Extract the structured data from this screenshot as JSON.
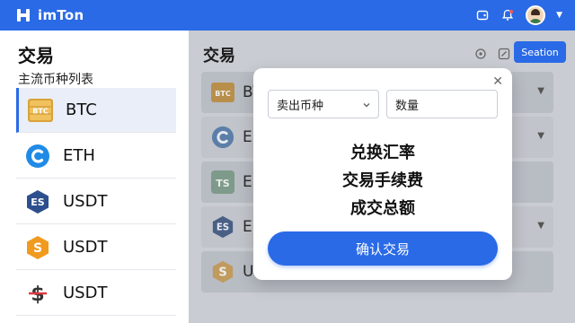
{
  "app": {
    "name": "imTon",
    "brand_color": "#2a6ae6",
    "top_icons": [
      "wallet-icon",
      "bell-icon",
      "avatar",
      "chevron-down-icon"
    ]
  },
  "sidebar": {
    "title": "交易",
    "subtitle": "主流币种列表",
    "items": [
      {
        "label": "BTC",
        "icon": "btc-coin-icon",
        "selected": true
      },
      {
        "label": "ETH",
        "icon": "eth-coin-icon"
      },
      {
        "label": "USDT",
        "icon": "es-coin-icon"
      },
      {
        "label": "USDT",
        "icon": "s-coin-icon"
      },
      {
        "label": "USDT",
        "icon": "dollar-coin-icon"
      }
    ]
  },
  "main": {
    "title": "交易",
    "action_button": "Seation",
    "rows": [
      {
        "label": "BTC",
        "icon": "btc-coin-icon"
      },
      {
        "label": "E",
        "icon": "eth-coin-icon"
      },
      {
        "label": "E",
        "icon": "ts-coin-icon"
      },
      {
        "label": "E",
        "icon": "es-coin-icon"
      },
      {
        "label": "USDT",
        "icon": "s-coin-icon"
      }
    ]
  },
  "modal": {
    "sell_select": "卖出币种",
    "quantity": "数量",
    "line1": "兑换汇率",
    "line2": "交易手续费",
    "line3": "成交总额",
    "confirm": "确认交易"
  }
}
